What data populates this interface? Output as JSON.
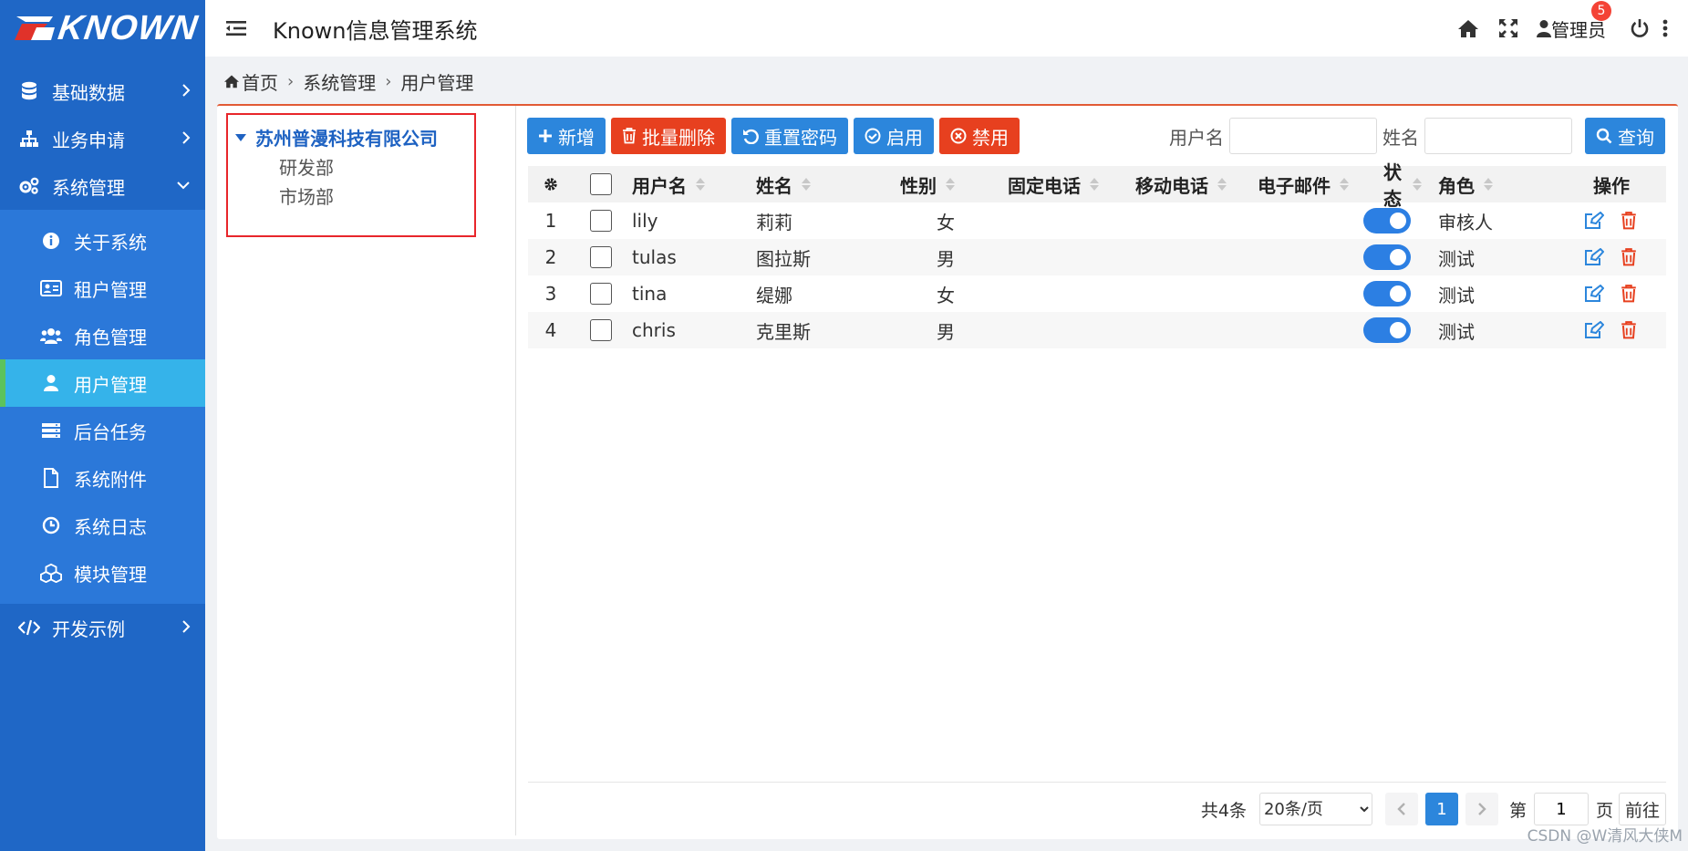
{
  "brand": {
    "logo_text": "KNOWN",
    "app_title": "Known信息管理系统"
  },
  "header": {
    "user_name": "管理员",
    "notification_count": "5"
  },
  "sidebar": {
    "top_items": [
      {
        "label": "基础数据"
      },
      {
        "label": "业务申请"
      },
      {
        "label": "系统管理"
      }
    ],
    "sub_items": [
      {
        "label": "关于系统"
      },
      {
        "label": "租户管理"
      },
      {
        "label": "角色管理"
      },
      {
        "label": "用户管理"
      },
      {
        "label": "后台任务"
      },
      {
        "label": "系统附件"
      },
      {
        "label": "系统日志"
      },
      {
        "label": "模块管理"
      }
    ],
    "bottom_item": {
      "label": "开发示例"
    },
    "active": "用户管理"
  },
  "breadcrumb": [
    "首页",
    "系统管理",
    "用户管理"
  ],
  "tree": {
    "root": "苏州普漫科技有限公司",
    "children": [
      "研发部",
      "市场部"
    ]
  },
  "toolbar": {
    "add": "新增",
    "batch_delete": "批量删除",
    "reset_password": "重置密码",
    "enable": "启用",
    "disable": "禁用"
  },
  "search": {
    "username_label": "用户名",
    "name_label": "姓名",
    "username_value": "",
    "name_value": "",
    "query": "查询"
  },
  "table": {
    "columns": [
      "用户名",
      "姓名",
      "性别",
      "固定电话",
      "移动电话",
      "电子邮件",
      "状态",
      "角色",
      "操作"
    ],
    "rows": [
      {
        "index": "1",
        "username": "lily",
        "name": "莉莉",
        "gender": "女",
        "phone": "",
        "mobile": "",
        "email": "",
        "enabled": true,
        "role": "审核人"
      },
      {
        "index": "2",
        "username": "tulas",
        "name": "图拉斯",
        "gender": "男",
        "phone": "",
        "mobile": "",
        "email": "",
        "enabled": true,
        "role": "测试"
      },
      {
        "index": "3",
        "username": "tina",
        "name": "缇娜",
        "gender": "女",
        "phone": "",
        "mobile": "",
        "email": "",
        "enabled": true,
        "role": "测试"
      },
      {
        "index": "4",
        "username": "chris",
        "name": "克里斯",
        "gender": "男",
        "phone": "",
        "mobile": "",
        "email": "",
        "enabled": true,
        "role": "测试"
      }
    ]
  },
  "pager": {
    "total": "共4条",
    "page_size": "20条/页",
    "current_page": "1",
    "goto_prefix": "第",
    "goto_value": "1",
    "goto_suffix": "页",
    "goto_button": "前往"
  },
  "watermark": "CSDN @W清风大侠M",
  "colors": {
    "sidebar": "#1f67c6",
    "sidebar_sub": "#2b78d9",
    "active_item": "#35b3ea",
    "primary": "#2c86dc",
    "danger": "#e7401f",
    "tree_highlight_border": "#e8262b"
  }
}
